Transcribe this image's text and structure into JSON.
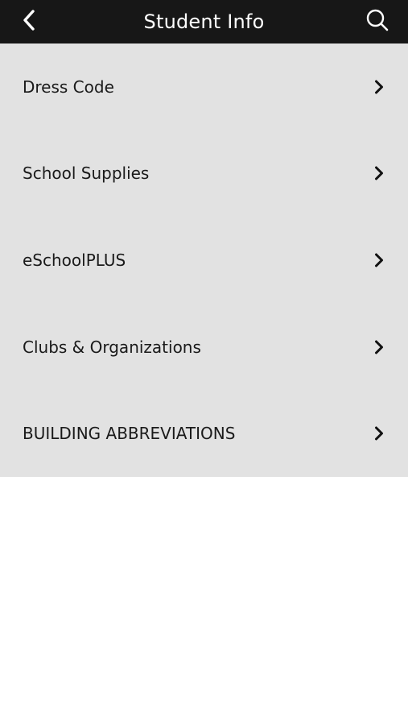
{
  "header": {
    "title": "Student Info",
    "back_icon": "chevron-left-icon",
    "search_icon": "search-icon"
  },
  "list": {
    "items": [
      {
        "label": "Dress Code"
      },
      {
        "label": "School Supplies"
      },
      {
        "label": "eSchoolPLUS"
      },
      {
        "label": "Clubs & Organizations"
      },
      {
        "label": "BUILDING ABBREVIATIONS"
      }
    ]
  },
  "colors": {
    "header_bg": "#171717",
    "list_bg": "#e2e2e2",
    "page_bg": "#ffffff",
    "text": "#1a1a1a"
  }
}
